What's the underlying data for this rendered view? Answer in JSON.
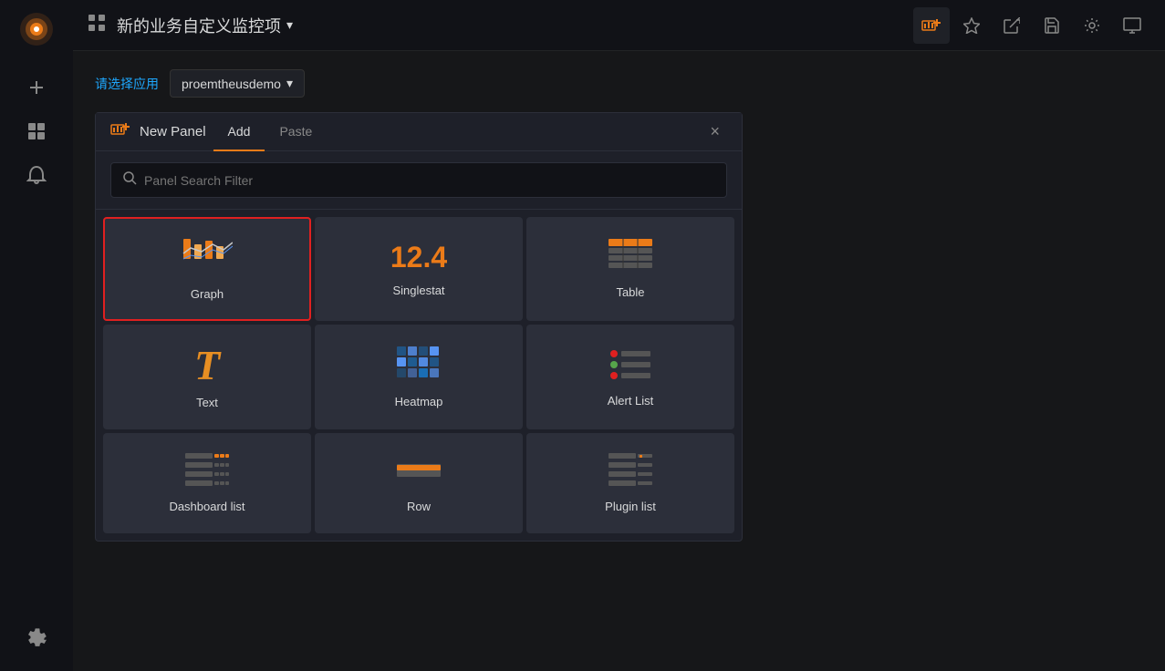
{
  "sidebar": {
    "items": [
      {
        "id": "logo",
        "label": "Grafana Logo",
        "icon": "🔥"
      },
      {
        "id": "add",
        "label": "Add",
        "icon": "+"
      },
      {
        "id": "dashboard",
        "label": "Dashboard",
        "icon": "⊞"
      },
      {
        "id": "alerts",
        "label": "Alerts",
        "icon": "🔔"
      },
      {
        "id": "settings",
        "label": "Settings",
        "icon": "⚙"
      }
    ]
  },
  "topbar": {
    "grid_icon": "⊞",
    "title": "新的业务自定义监控项",
    "dropdown_arrow": "▾",
    "buttons": [
      {
        "id": "add-panel",
        "label": "Add Panel",
        "icon": "📊+"
      },
      {
        "id": "star",
        "label": "Star",
        "icon": "☆"
      },
      {
        "id": "share",
        "label": "Share",
        "icon": "↗"
      },
      {
        "id": "save",
        "label": "Save",
        "icon": "💾"
      },
      {
        "id": "cog",
        "label": "Settings",
        "icon": "⚙"
      },
      {
        "id": "monitor",
        "label": "TV Mode",
        "icon": "🖥"
      }
    ]
  },
  "filter": {
    "label": "请选择应用",
    "select": {
      "value": "proemtheusdemo",
      "arrow": "▾"
    }
  },
  "panel_picker": {
    "icon": "📊",
    "title": "New Panel",
    "tabs": [
      {
        "id": "add",
        "label": "Add",
        "active": true
      },
      {
        "id": "paste",
        "label": "Paste",
        "active": false
      }
    ],
    "close_label": "×",
    "search": {
      "placeholder": "Panel Search Filter"
    },
    "panels": [
      {
        "id": "graph",
        "label": "Graph",
        "selected": true
      },
      {
        "id": "singlestat",
        "label": "Singlestat"
      },
      {
        "id": "table",
        "label": "Table"
      },
      {
        "id": "text",
        "label": "Text"
      },
      {
        "id": "heatmap",
        "label": "Heatmap"
      },
      {
        "id": "alertlist",
        "label": "Alert List"
      },
      {
        "id": "dashlist",
        "label": "Dashboard list"
      },
      {
        "id": "row",
        "label": "Row"
      },
      {
        "id": "pluginlist",
        "label": "Plugin list"
      }
    ]
  }
}
